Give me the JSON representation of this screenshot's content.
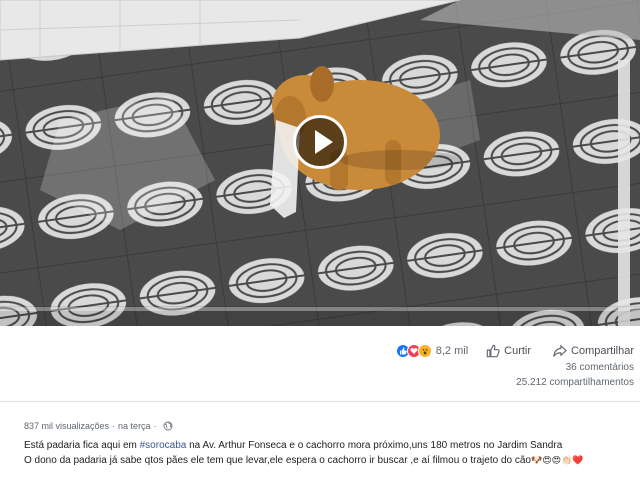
{
  "video": {
    "play_icon": "play-icon",
    "progress": 0.0,
    "colors": {
      "tile_dark": "#4a4a4a",
      "tile_light": "#d9d9d9",
      "dog": "#c98a3a",
      "wall": "#e8e8e8"
    }
  },
  "actions": {
    "reaction_icons": [
      "like-icon",
      "love-icon",
      "wow-icon"
    ],
    "reaction_count": "8,2 mil",
    "like_label": "Curtir",
    "share_label": "Compartilhar"
  },
  "stats": {
    "comments": "36 comentários",
    "shares": "25.212 compartilhamentos"
  },
  "post": {
    "views": "837 mil visualizações",
    "separator": "·",
    "time": "na terça",
    "privacy_icon": "globe-icon"
  },
  "caption": {
    "line1_before": "Está padaria fica aqui em ",
    "hashtag": "#sorocaba",
    "line1_after": " na Av. Arthur Fonseca e o cachorro mora próximo,uns 180 metros no Jardim Sandra",
    "line2": "O dono da padaria já sabe qtos pães ele tem que levar,ele espera o cachorro ir buscar ,e aí filmou o trajeto do cão",
    "emojis": "🐶😍😍👏🏻❤️"
  },
  "colors": {
    "accent": "#385898",
    "muted": "#606770",
    "text": "#1c1e21"
  }
}
